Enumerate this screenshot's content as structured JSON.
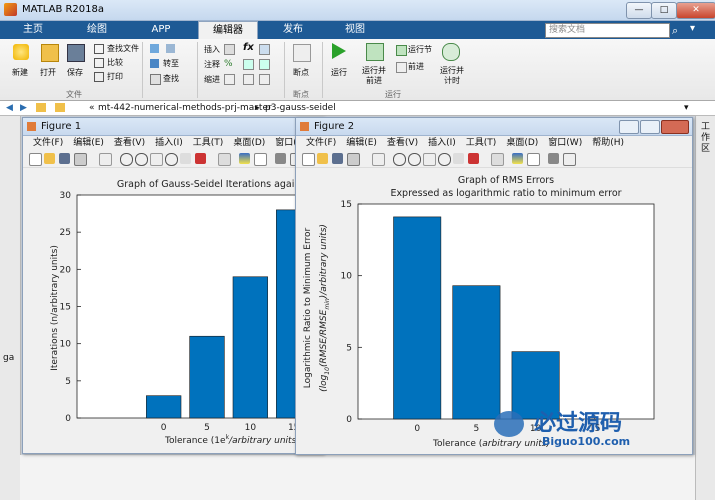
{
  "app": {
    "title": "MATLAB R2018a",
    "tabs": [
      "主页",
      "绘图",
      "APP",
      "编辑器",
      "发布",
      "视图"
    ],
    "active_tab": "编辑器",
    "search_placeholder": "搜索文档"
  },
  "ribbon": {
    "file": {
      "new": "新建",
      "open": "打开",
      "save": "保存",
      "find_files": "查找文件",
      "compare": "比较",
      "print": "打印",
      "group": "文件"
    },
    "nav": {
      "goto": "转至",
      "find": "查找"
    },
    "edit": {
      "insert": "插入",
      "comment": "注释",
      "indent": "缩进",
      "fx": "fx"
    },
    "breakpoints": {
      "label": "断点",
      "group": "断点"
    },
    "run": {
      "run": "运行",
      "run_advance": "运行并\n前进",
      "run_section": "运行节",
      "advance": "前进",
      "run_time": "运行并\n计时",
      "group": "运行"
    }
  },
  "address": {
    "sep": "«",
    "path1": "mt-442-numerical-methods-prj-master",
    "path2": "p3-gauss-seidel"
  },
  "right_strip_label": "工作区",
  "left_panel_fragment": "ga",
  "figure1": {
    "title": "Figure 1",
    "menu": [
      "文件(F)",
      "编辑(E)",
      "查看(V)",
      "插入(I)",
      "工具(T)",
      "桌面(D)",
      "窗口(W)"
    ]
  },
  "figure2": {
    "title": "Figure 2",
    "menu": [
      "文件(F)",
      "编辑(E)",
      "查看(V)",
      "插入(I)",
      "工具(T)",
      "桌面(D)",
      "窗口(W)",
      "帮助(H)"
    ]
  },
  "chart_data": [
    {
      "type": "bar",
      "title": "Graph of Gauss-Seidel Iterations against",
      "xlabel": "Tolerance (1e",
      "xlabel_sup": "k",
      "xlabel_tail": "/arbitrary units)",
      "ylabel": "Iterations (n/arbitrary units)",
      "categories": [
        "0",
        "5",
        "10",
        "15"
      ],
      "x": [
        0,
        5,
        10,
        15
      ],
      "values": [
        3,
        11,
        19,
        28
      ],
      "ylim": [
        0,
        30
      ],
      "yticks": [
        0,
        5,
        10,
        15,
        20,
        25,
        30
      ],
      "grid": false,
      "color": "#0072bd"
    },
    {
      "type": "bar",
      "title": "Graph of RMS Errors",
      "subtitle": "Expressed as logarithmic ratio to minimum error",
      "xlabel": "Tolerance (",
      "xlabel_tail": "arbitrary units)",
      "ylabel": "Logarithmic Ratio to Minimum Error",
      "ylabel2": "(log",
      "ylabel2_sub": "10",
      "ylabel2_tail": "(RMSE/RMSE",
      "ylabel2_sub2": "min",
      "ylabel2_end": ")/arbitrary units)",
      "categories": [
        "0",
        "5",
        "10",
        "15"
      ],
      "x": [
        0,
        5,
        10,
        15
      ],
      "values": [
        14.1,
        9.3,
        4.7
      ],
      "ylim": [
        0,
        15
      ],
      "yticks": [
        0,
        5,
        10,
        15
      ],
      "grid": false,
      "color": "#0072bd"
    }
  ],
  "watermark": {
    "text": "必过源码",
    "url": "Biguo100.com"
  },
  "colors": {
    "bar": "#0072bd",
    "ribbon_tab_bg": "#1e5a95"
  }
}
